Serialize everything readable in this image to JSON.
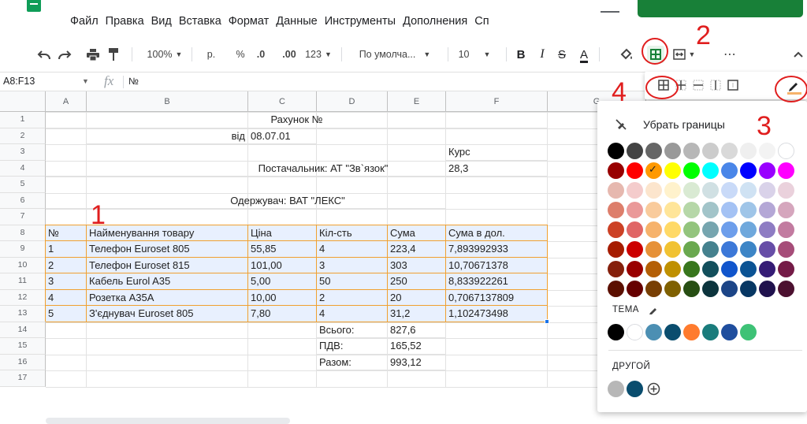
{
  "menu": {
    "items": [
      "Файл",
      "Правка",
      "Вид",
      "Вставка",
      "Формат",
      "Данные",
      "Инструменты",
      "Дополнения",
      "Сп"
    ]
  },
  "toolbar": {
    "zoom": "100%",
    "currency": "р.",
    "percent": "%",
    "dec_decrease": ".0",
    "dec_increase": ".00",
    "more_formats": "123",
    "font": "По умолча...",
    "font_size": "10",
    "bold": "B",
    "italic": "I",
    "strike": "S",
    "text_color": "A",
    "more": "⋯",
    "collapse": "^"
  },
  "formula_bar": {
    "name_box": "A8:F13",
    "fx": "fx",
    "content": "№"
  },
  "columns": [
    "A",
    "B",
    "C",
    "D",
    "E",
    "F",
    "G"
  ],
  "rows": [
    "1",
    "2",
    "3",
    "4",
    "5",
    "6",
    "7",
    "8",
    "9",
    "10",
    "11",
    "12",
    "13",
    "14",
    "15",
    "16",
    "17"
  ],
  "sheet": {
    "title": "Рахунок №",
    "date_label": "від",
    "date_value": "08.07.01",
    "rate_label": "Курс",
    "supplier": "Постачальник: АТ \"Зв`язок\"",
    "rate_value": "28,3",
    "recipient": "Одержувач: ВАТ \"ЛЕКС\"",
    "headers": [
      "№",
      "Найменування товару",
      "Ціна",
      "Кіл-сть",
      "Сума",
      "Сума в дол."
    ],
    "data": [
      [
        "1",
        "Телефон Euroset 805",
        "55,85",
        "4",
        "223,4",
        "7,893992933"
      ],
      [
        "2",
        "Телефон Euroset 815",
        "101,00",
        "3",
        "303",
        "10,70671378"
      ],
      [
        "3",
        "Кабель  Eurol A35",
        "5,00",
        "50",
        "250",
        "8,833922261"
      ],
      [
        "4",
        "Розетка А35А",
        "10,00",
        "2",
        "20",
        "0,7067137809"
      ],
      [
        "5",
        "З'єднувач Euroset 805",
        "7,80",
        "4",
        "31,2",
        "1,102473498"
      ]
    ],
    "totals": [
      {
        "label": "Всього:",
        "value": "827,6"
      },
      {
        "label": "ПДВ:",
        "value": "165,52"
      },
      {
        "label": "Разом:",
        "value": "993,12"
      }
    ]
  },
  "border_menu": {
    "clear_label": "Убрать границы",
    "theme_label": "ТЕМА",
    "custom_label": "ДРУГОЙ",
    "palette": [
      [
        "#000000",
        "#434343",
        "#666666",
        "#999999",
        "#b7b7b7",
        "#cccccc",
        "#d9d9d9",
        "#efefef",
        "#f3f3f3",
        "#ffffff"
      ],
      [
        "#980000",
        "#ff0000",
        "#ff9900",
        "#ffff00",
        "#00ff00",
        "#00ffff",
        "#4a86e8",
        "#0000ff",
        "#9900ff",
        "#ff00ff"
      ],
      [
        "#e6b8af",
        "#f4cccc",
        "#fce5cd",
        "#fff2cc",
        "#d9ead3",
        "#d0e0e3",
        "#c9daf8",
        "#cfe2f3",
        "#d9d2e9",
        "#ead1dc"
      ],
      [
        "#dd7e6b",
        "#ea9999",
        "#f9cb9c",
        "#ffe599",
        "#b6d7a8",
        "#a2c4c9",
        "#a4c2f4",
        "#9fc5e8",
        "#b4a7d6",
        "#d5a6bd"
      ],
      [
        "#cc4125",
        "#e06666",
        "#f6b26b",
        "#ffd966",
        "#93c47d",
        "#76a5af",
        "#6d9eeb",
        "#6fa8dc",
        "#8e7cc3",
        "#c27ba0"
      ],
      [
        "#a61c00",
        "#cc0000",
        "#e69138",
        "#f1c232",
        "#6aa84f",
        "#45818e",
        "#3c78d8",
        "#3d85c6",
        "#674ea7",
        "#a64d79"
      ],
      [
        "#85200c",
        "#990000",
        "#b45f06",
        "#bf9000",
        "#38761d",
        "#134f5c",
        "#1155cc",
        "#0b5394",
        "#351c75",
        "#741b47"
      ],
      [
        "#5b0f00",
        "#660000",
        "#783f04",
        "#7f6000",
        "#274e13",
        "#0c343d",
        "#1c4587",
        "#073763",
        "#20124d",
        "#4c1130"
      ]
    ],
    "theme": [
      "#000000",
      "#ffffff",
      "#4c8fb3",
      "#0a4d6e",
      "#ff7b2e",
      "#1a7c7c",
      "#1f4e9e",
      "#3ec276"
    ],
    "custom": [
      "#b7b7b7",
      "#0a4d6e"
    ],
    "selected_color": "#ff9900"
  },
  "annotations": [
    "1",
    "2",
    "3",
    "4"
  ]
}
